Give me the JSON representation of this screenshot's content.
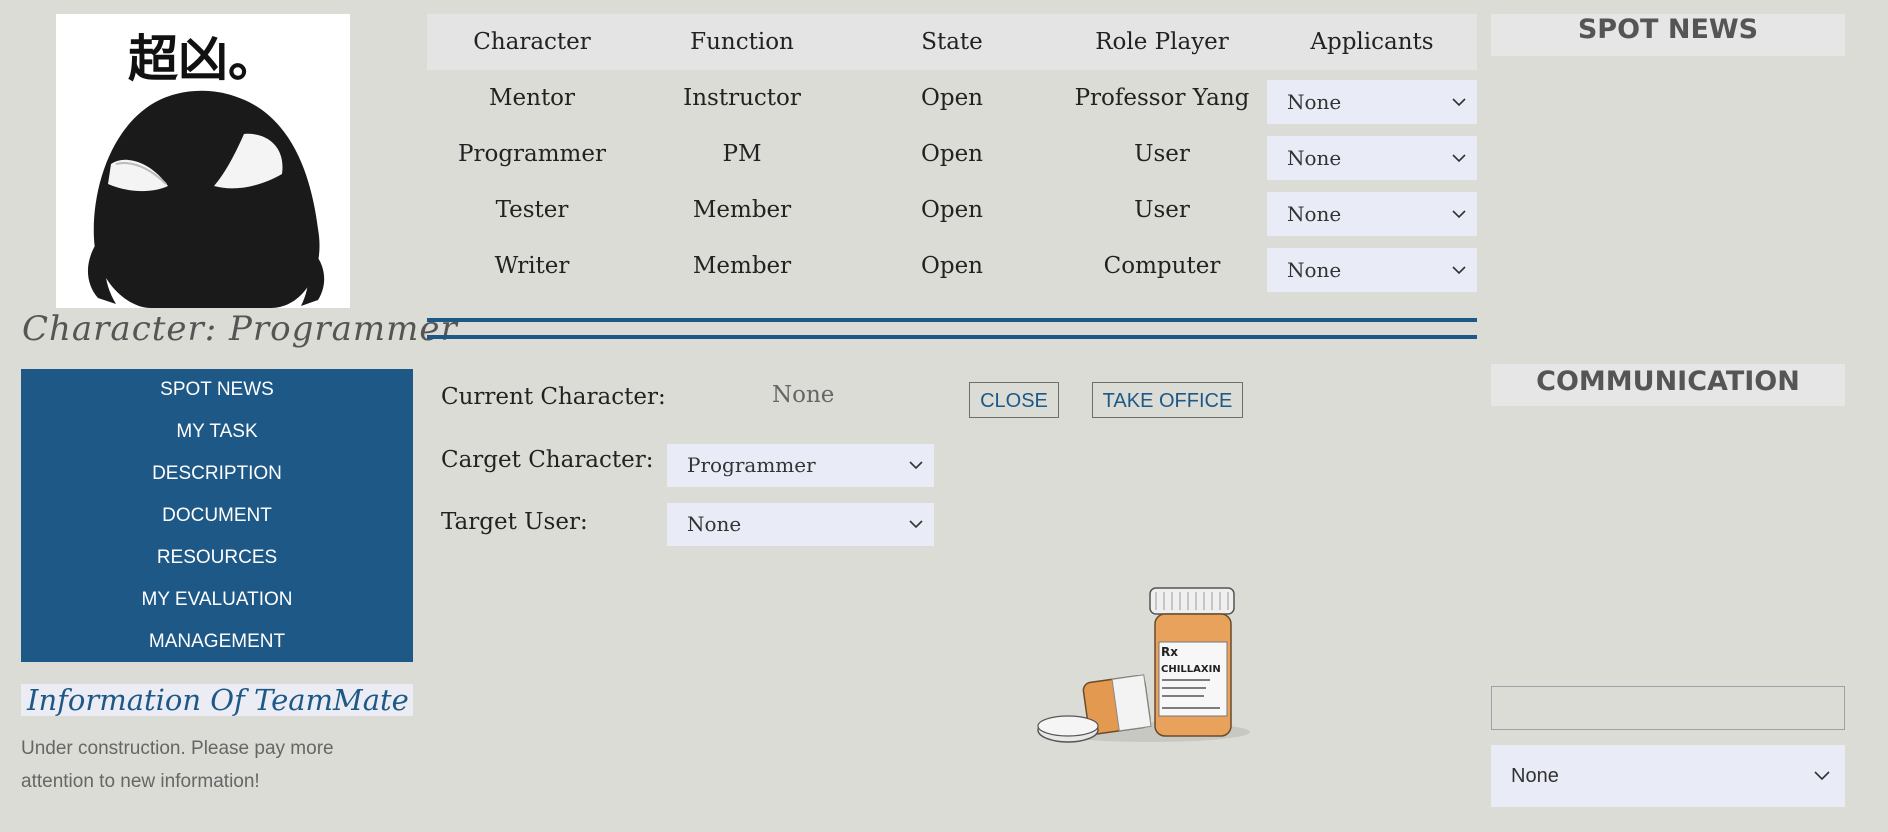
{
  "profile": {
    "avatar_caption": "超凶。",
    "title": "Character: Programmer"
  },
  "nav": {
    "items": [
      {
        "label": "SPOT NEWS"
      },
      {
        "label": "MY TASK"
      },
      {
        "label": "DESCRIPTION"
      },
      {
        "label": "DOCUMENT"
      },
      {
        "label": "RESOURCES"
      },
      {
        "label": "MY EVALUATION"
      },
      {
        "label": "MANAGEMENT"
      }
    ]
  },
  "teammate": {
    "heading": "Information Of TeamMate",
    "text": "Under construction. Please pay more attention to new information!"
  },
  "roles_table": {
    "headers": [
      "Character",
      "Function",
      "State",
      "Role Player",
      "Applicants"
    ],
    "rows": [
      {
        "character": "Mentor",
        "function": "Instructor",
        "state": "Open",
        "role_player": "Professor Yang",
        "applicants": "None"
      },
      {
        "character": "Programmer",
        "function": "PM",
        "state": "Open",
        "role_player": "User",
        "applicants": "None"
      },
      {
        "character": "Tester",
        "function": "Member",
        "state": "Open",
        "role_player": "User",
        "applicants": "None"
      },
      {
        "character": "Writer",
        "function": "Member",
        "state": "Open",
        "role_player": "Computer",
        "applicants": "None"
      }
    ]
  },
  "office_form": {
    "current_character_label": "Current Character:",
    "current_character_value": "None",
    "close_label": "CLOSE",
    "take_office_label": "TAKE OFFICE",
    "target_character_label": "Carget Character:",
    "target_character_value": "Programmer",
    "target_user_label": "Target User:",
    "target_user_value": "None",
    "pill_bottle_label": "CHILLAXIN"
  },
  "sidebar_right": {
    "spot_news_heading": "SPOT NEWS",
    "communication_heading": "COMMUNICATION",
    "message_value": "",
    "recipient_value": "None"
  },
  "icons": {
    "dropdown": "chevron-down-icon"
  },
  "colors": {
    "background": "#dcdcd6",
    "accent_blue": "#1d5887",
    "select_bg": "#e9ecf6"
  }
}
